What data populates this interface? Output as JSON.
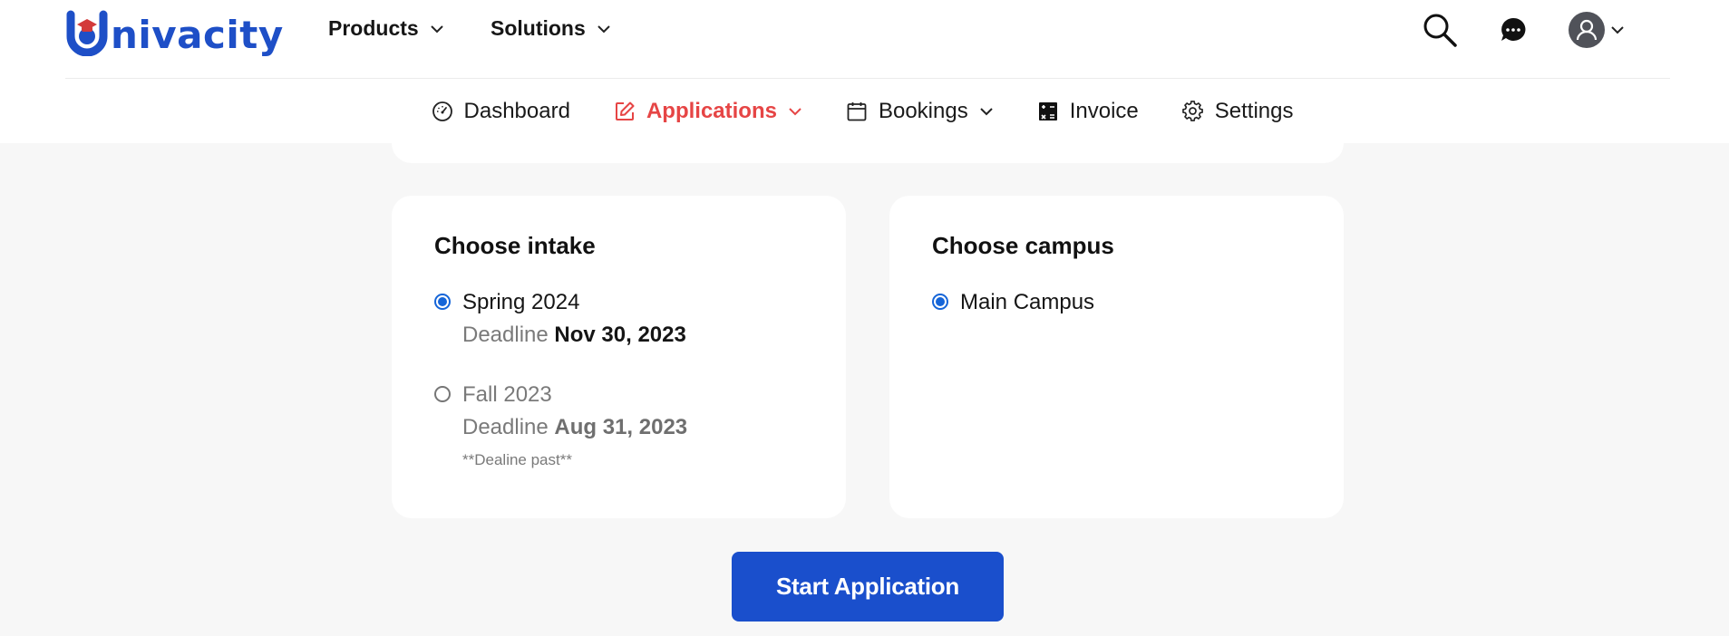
{
  "brand": {
    "name": "nivacity",
    "color": "#1e4fc7",
    "cap_color": "#d33a3a"
  },
  "topnav": {
    "items": [
      {
        "label": "Products",
        "icon": "chevron-down-icon"
      },
      {
        "label": "Solutions",
        "icon": "chevron-down-icon"
      }
    ],
    "icons": [
      "search-icon",
      "chat-icon",
      "user-avatar-icon",
      "chevron-down-icon"
    ]
  },
  "subnav": {
    "active_color": "#e64545",
    "items": [
      {
        "label": "Dashboard",
        "icon": "gauge-icon"
      },
      {
        "label": "Applications",
        "icon": "edit-icon",
        "active": true
      },
      {
        "label": "Bookings",
        "icon": "calendar-icon"
      },
      {
        "label": "Invoice",
        "icon": "invoice-icon"
      },
      {
        "label": "Settings",
        "icon": "gear-icon"
      }
    ]
  },
  "intake": {
    "title": "Choose intake",
    "options": [
      {
        "name": "Spring 2024",
        "deadline_label": "Deadline",
        "deadline": "Nov 30, 2023",
        "checked": true
      },
      {
        "name": "Fall 2023",
        "deadline_label": "Deadline",
        "deadline": "Aug 31, 2023",
        "checked": false,
        "note": "**Dealine past**"
      }
    ]
  },
  "campus": {
    "title": "Choose campus",
    "options": [
      {
        "name": "Main Campus",
        "checked": true
      }
    ]
  },
  "actions": {
    "start_label": "Start Application",
    "button_color": "#1a4fcc"
  }
}
